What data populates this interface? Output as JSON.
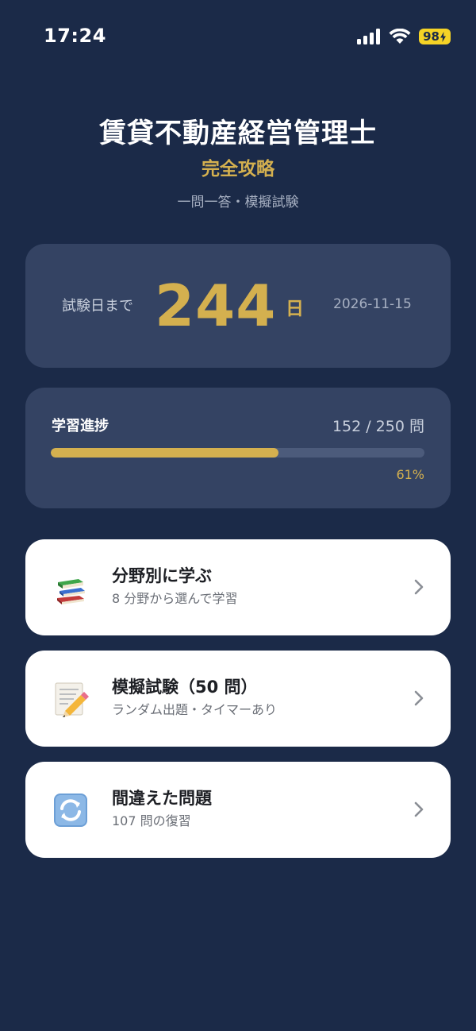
{
  "status_bar": {
    "time": "17:24",
    "battery": "98"
  },
  "header": {
    "title": "賃貸不動産経営管理士",
    "subtitle": "完全攻略",
    "tagline": "一問一答・模擬試験"
  },
  "countdown": {
    "label": "試験日まで",
    "days": "244",
    "unit": "日",
    "date": "2026-11-15"
  },
  "progress": {
    "label": "学習進捗",
    "count": "152 / 250 問",
    "percent_text": "61%",
    "fraction": 0.61
  },
  "menu": {
    "study": {
      "title": "分野別に学ぶ",
      "desc": "8 分野から選んで学習",
      "icon": "books-icon"
    },
    "mock": {
      "title": "模擬試験（50 問）",
      "desc": "ランダム出題・タイマーあり",
      "icon": "memo-pencil-icon"
    },
    "review": {
      "title": "間違えた問題",
      "desc": "107 問の復習",
      "icon": "refresh-icon"
    }
  },
  "colors": {
    "background": "#1b2a48",
    "card": "#344363",
    "accent": "#d4b04f",
    "battery": "#f5d326"
  }
}
